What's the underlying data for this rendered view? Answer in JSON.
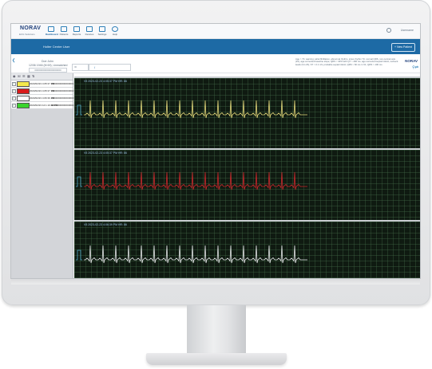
{
  "brand": {
    "name": "NORAV",
    "subtitle": "ECG Solutions"
  },
  "nav": {
    "items": [
      {
        "label": "Dashboard",
        "active": true
      },
      {
        "label": "Patients",
        "active": false
      },
      {
        "label": "Reports",
        "active": false
      },
      {
        "label": "Devices",
        "active": false
      },
      {
        "label": "Settings",
        "active": false
      },
      {
        "label": "Help",
        "active": false
      }
    ],
    "user_label": "Username"
  },
  "header": {
    "title": "Holter Center User",
    "new_patient_label": "+ New Patient"
  },
  "patient": {
    "name": "Doe John",
    "meta": "12/06 1946 (M 69), Unmatched",
    "id": "00000000000000000000",
    "search_placeholder": "ID",
    "edit_value": "/",
    "interpretation": "Age > 70, warning: atrial fibrillation, abnormal rhythm, sinus rhythm 70, normal QRS, non-normal axis (10), age-corrected baseline slope; QRS < 40% with QT > 460 ms, age-corrected septal infarct, recheck leads (V1-V3); ST > 0.1 mV, probable septal infarct; QRS > 60 ms in V1; QRS > 100 ms",
    "brand_small": "NORAV"
  },
  "sidebar": {
    "toolbar_icons": [
      "eye-icon",
      "trash-icon",
      "list-icon",
      "grid-icon",
      "sort-icon"
    ],
    "records": [
      {
        "checked": true,
        "swatch": "#f4e94c",
        "date": "2023/02/23 4:05:37 PM",
        "id": "00000000000000001"
      },
      {
        "checked": true,
        "swatch": "#d91b1b",
        "date": "2023/02/23 4:05:37 PM",
        "id": "00000000000000002"
      },
      {
        "checked": true,
        "swatch": "#ffffff",
        "date": "2023/02/23 4:06:39 PM",
        "id": "00000000000000003"
      },
      {
        "checked": true,
        "swatch": "#39d42c",
        "date": "2023/02/23 12:1:10:42 PM",
        "id": "00000000000000004"
      }
    ]
  },
  "panels": [
    {
      "label": "V5     2023-02-23 4:05:37 PM     HR: 86",
      "color": "#e3d87a"
    },
    {
      "label": "V5     2023-02-23 4:05:37 PM     HR: 86",
      "color": "#c8262b"
    },
    {
      "label": "V5     2023-02-23 4:06:39 PM     HR: 86",
      "color": "#e4e6e8"
    }
  ],
  "colors": {
    "accent": "#1d6aa5",
    "ecg_background": "#0f1a11",
    "grid": "#46704b"
  }
}
